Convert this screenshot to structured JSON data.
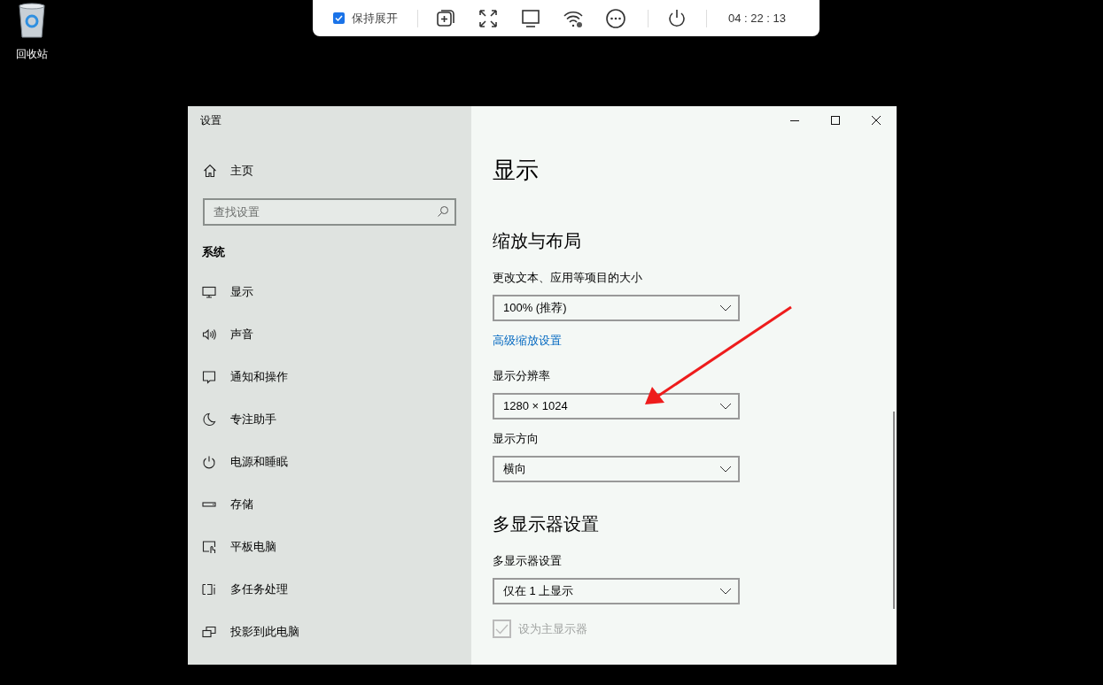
{
  "desktop_icons": [
    {
      "label": "回收站"
    }
  ],
  "toolbar": {
    "keep_expanded": {
      "label": "保持展开",
      "checked": true
    },
    "time": "04 : 22 : 13"
  },
  "window": {
    "title": "设置",
    "sidebar": {
      "home": "主页",
      "search": {
        "placeholder": "查找设置"
      },
      "section": "系统",
      "items": [
        {
          "kind": "display",
          "label": "显示"
        },
        {
          "kind": "sound",
          "label": "声音"
        },
        {
          "kind": "notifications",
          "label": "通知和操作"
        },
        {
          "kind": "focus",
          "label": "专注助手"
        },
        {
          "kind": "power",
          "label": "电源和睡眠"
        },
        {
          "kind": "storage",
          "label": "存储"
        },
        {
          "kind": "tablet",
          "label": "平板电脑"
        },
        {
          "kind": "multitask",
          "label": "多任务处理"
        },
        {
          "kind": "project",
          "label": "投影到此电脑"
        }
      ]
    },
    "page": {
      "title": "显示",
      "sections": [
        {
          "heading": "缩放与布局",
          "settings": [
            {
              "kind": "dropdown",
              "label": "更改文本、应用等项目的大小",
              "value": "100% (推荐)"
            },
            {
              "kind": "link",
              "label": "高级缩放设置"
            },
            {
              "kind": "dropdown",
              "label": "显示分辨率",
              "value": "1280 × 1024"
            },
            {
              "kind": "dropdown",
              "label": "显示方向",
              "value": "横向"
            }
          ]
        },
        {
          "heading": "多显示器设置",
          "settings": [
            {
              "kind": "dropdown",
              "label": "多显示器设置",
              "value": "仅在 1 上显示"
            },
            {
              "kind": "checkbox",
              "label": "设为主显示器",
              "checked": true,
              "disabled": true
            }
          ]
        }
      ]
    }
  }
}
